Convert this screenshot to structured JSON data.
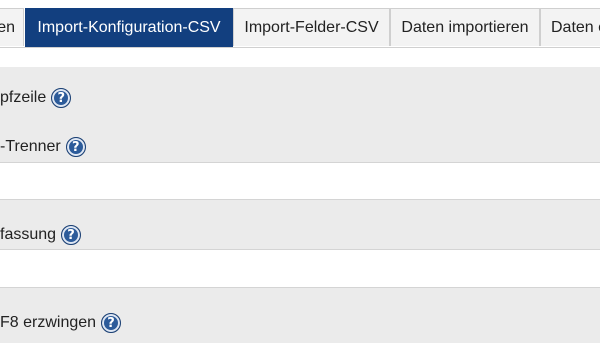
{
  "tabs": [
    {
      "label": "en"
    },
    {
      "label": "Import-Konfiguration-CSV",
      "active": true
    },
    {
      "label": "Import-Felder-CSV"
    },
    {
      "label": "Daten importieren"
    },
    {
      "label": "Daten e"
    }
  ],
  "form": {
    "fields": [
      {
        "label": "pfzeile",
        "help": "?"
      },
      {
        "label": "-Trenner",
        "help": "?"
      },
      {
        "label": "fassung",
        "help": "?"
      },
      {
        "label": "F8 erzwingen",
        "help": "?"
      }
    ]
  },
  "colors": {
    "active_tab": "#123f7f",
    "help_icon": "#2c5b9a",
    "row_gray": "#ebebeb"
  }
}
